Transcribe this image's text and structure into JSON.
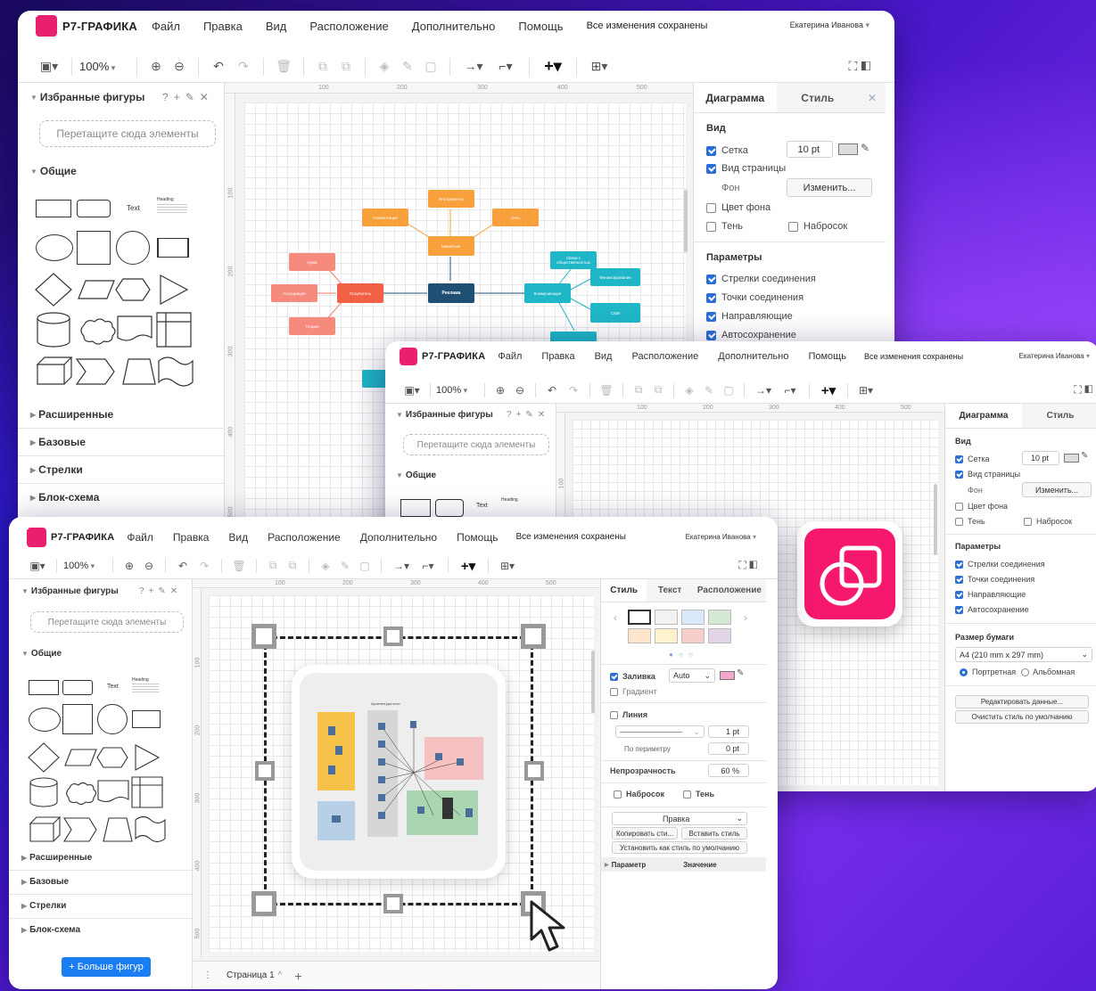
{
  "app": {
    "logo": "Р7-ГРАФИКА",
    "menu": [
      "Файл",
      "Правка",
      "Вид",
      "Расположение",
      "Дополнительно",
      "Помощь"
    ],
    "saved_status": "Все изменения сохранены",
    "user": "Екатерина Иванова",
    "zoom": "100%"
  },
  "left_panel": {
    "favorites": "Избранные фигуры",
    "help": "?",
    "add": "+",
    "dropzone": "Перетащите сюда элементы",
    "general": "Общие",
    "sections": [
      "Расширенные",
      "Базовые",
      "Стрелки",
      "Блок-схема"
    ],
    "more_shapes": "+ Больше фигур",
    "text_shape": "Text",
    "heading_shape": "Heading"
  },
  "ruler": {
    "h": [
      "100",
      "200",
      "300",
      "400",
      "500"
    ],
    "v": [
      "100",
      "200",
      "300",
      "400",
      "500"
    ]
  },
  "diagram_panel": {
    "tabs": [
      "Диаграмма",
      "Стиль"
    ],
    "view_header": "Вид",
    "grid": "Сетка",
    "grid_value": "10 pt",
    "page_view": "Вид страницы",
    "background": "Фон",
    "change": "Изменить...",
    "bg_color": "Цвет фона",
    "shadow": "Тень",
    "sketch": "Набросок",
    "params_header": "Параметры",
    "params": [
      "Стрелки соединения",
      "Точки соединения",
      "Направляющие",
      "Автосохранение"
    ],
    "paper_header": "Размер бумаги",
    "paper_value": "A4 (210 mm x 297 mm)",
    "portrait": "Портретная",
    "landscape": "Альбомная",
    "edit_data": "Редактировать данные...",
    "clear_style": "Очистить стиль по умолчанию"
  },
  "mindmap": {
    "center": "Реклама",
    "marketing": "Маркетинг",
    "consumer": "Покупатель",
    "communication": "Коммуникация",
    "tools": "Инструменты",
    "segmentation": "Сегментация",
    "channels": "Сеть",
    "needs": "Нужи",
    "association": "Ассоциация",
    "theory": "Теория",
    "public": "Связи с общественностью",
    "finance": "Финансирование",
    "media": "СМИ"
  },
  "style_panel": {
    "tabs": [
      "Стиль",
      "Текст",
      "Расположение"
    ],
    "fill": "Заливка",
    "fill_value": "Auto",
    "gradient": "Градиент",
    "line": "Линия",
    "line_width": "1 pt",
    "perimeter": "По периметру",
    "perimeter_value": "0 pt",
    "opacity": "Непрозрачность",
    "opacity_value": "60 %",
    "sketch": "Набросок",
    "shadow": "Тень",
    "edit": "Правка",
    "copy_style": "Копировать сти...",
    "paste_style": "Вставить стиль",
    "set_default": "Установить как стиль по умолчанию",
    "param": "Параметр",
    "value": "Значение"
  },
  "network": {
    "title": "Архитектура сети"
  },
  "page_tab": "Страница 1",
  "colors": {
    "accent": "#e8206e",
    "orange": "#f7a03c",
    "salmon": "#f07a66",
    "teal": "#1fb6c7",
    "navy": "#1f4f72",
    "check": "#2b6fd6",
    "more": "#1a7ef2"
  }
}
